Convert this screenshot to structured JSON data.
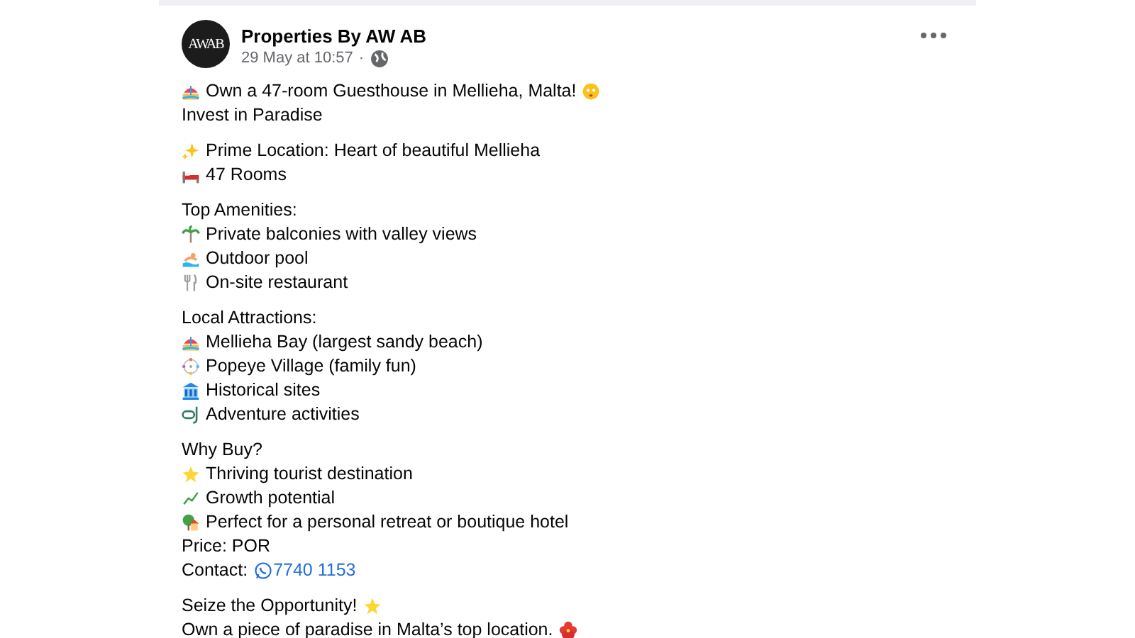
{
  "post": {
    "author": "Properties By AW AB",
    "avatar_text": "AWAB",
    "time": "29 May at 10:57",
    "separator": "·"
  },
  "paragraphs": [
    [
      {
        "text": "Own a 47-room Guesthouse in Mellieha, Malta!"
      },
      {
        "text": "Invest in Paradise"
      }
    ],
    [
      {
        "text": "Prime Location: Heart of beautiful Mellieha"
      },
      {
        "text": "47 Rooms"
      }
    ],
    [
      {
        "text": "Top Amenities:"
      },
      {
        "text": "Private balconies with valley views"
      },
      {
        "text": "Outdoor pool"
      },
      {
        "text": "On-site restaurant"
      }
    ],
    [
      {
        "text": "Local Attractions:"
      },
      {
        "text": "Mellieha Bay (largest sandy beach)"
      },
      {
        "text": "Popeye Village (family fun)"
      },
      {
        "text": "Historical sites"
      },
      {
        "text": "Adventure activities"
      }
    ],
    [
      {
        "text": "Why Buy?"
      },
      {
        "text": "Thriving tourist destination"
      },
      {
        "text": "Growth potential"
      },
      {
        "text": "Perfect for a personal retreat or boutique hotel"
      },
      {
        "text": "Price: POR"
      },
      {
        "text": "Contact:",
        "link": "7740 1153"
      }
    ],
    [
      {
        "text": "Seize the Opportunity!"
      },
      {
        "text": "Own a piece of paradise in Malta’s top location."
      }
    ]
  ]
}
